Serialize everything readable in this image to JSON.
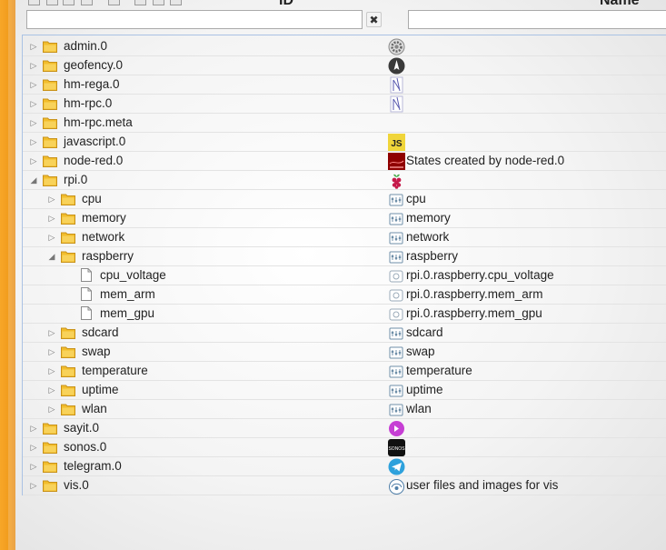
{
  "header": {
    "id_label": "ID",
    "name_label": "Name"
  },
  "filters": {
    "id_value": "",
    "name_value": "",
    "clear_label": "✖"
  },
  "rows": [
    {
      "label": "admin.0",
      "name": "",
      "depth": 0,
      "type": "folder",
      "state": "collapsed",
      "icon": "gear-icon"
    },
    {
      "label": "geofency.0",
      "name": "",
      "depth": 0,
      "type": "folder",
      "state": "collapsed",
      "icon": "compass-icon"
    },
    {
      "label": "hm-rega.0",
      "name": "",
      "depth": 0,
      "type": "folder",
      "state": "collapsed",
      "icon": "homematic-icon"
    },
    {
      "label": "hm-rpc.0",
      "name": "",
      "depth": 0,
      "type": "folder",
      "state": "collapsed",
      "icon": "homematic-icon"
    },
    {
      "label": "hm-rpc.meta",
      "name": "",
      "depth": 0,
      "type": "folder",
      "state": "collapsed",
      "icon": ""
    },
    {
      "label": "javascript.0",
      "name": "",
      "depth": 0,
      "type": "folder",
      "state": "collapsed",
      "icon": "js-icon"
    },
    {
      "label": "node-red.0",
      "name": "States created by node-red.0",
      "depth": 0,
      "type": "folder",
      "state": "collapsed",
      "icon": "node-red-icon"
    },
    {
      "label": "rpi.0",
      "name": "",
      "depth": 0,
      "type": "folder",
      "state": "expanded",
      "icon": "raspberry-icon"
    },
    {
      "label": "cpu",
      "name": "cpu",
      "depth": 1,
      "type": "folder",
      "state": "collapsed",
      "icon": "channel-icon"
    },
    {
      "label": "memory",
      "name": "memory",
      "depth": 1,
      "type": "folder",
      "state": "collapsed",
      "icon": "channel-icon"
    },
    {
      "label": "network",
      "name": "network",
      "depth": 1,
      "type": "folder",
      "state": "collapsed",
      "icon": "channel-icon"
    },
    {
      "label": "raspberry",
      "name": "raspberry",
      "depth": 1,
      "type": "folder",
      "state": "expanded",
      "icon": "channel-icon"
    },
    {
      "label": "cpu_voltage",
      "name": "rpi.0.raspberry.cpu_voltage",
      "depth": 2,
      "type": "file",
      "state": "leaf",
      "icon": "state-icon"
    },
    {
      "label": "mem_arm",
      "name": "rpi.0.raspberry.mem_arm",
      "depth": 2,
      "type": "file",
      "state": "leaf",
      "icon": "state-icon"
    },
    {
      "label": "mem_gpu",
      "name": "rpi.0.raspberry.mem_gpu",
      "depth": 2,
      "type": "file",
      "state": "leaf",
      "icon": "state-icon"
    },
    {
      "label": "sdcard",
      "name": "sdcard",
      "depth": 1,
      "type": "folder",
      "state": "collapsed",
      "icon": "channel-icon"
    },
    {
      "label": "swap",
      "name": "swap",
      "depth": 1,
      "type": "folder",
      "state": "collapsed",
      "icon": "channel-icon"
    },
    {
      "label": "temperature",
      "name": "temperature",
      "depth": 1,
      "type": "folder",
      "state": "collapsed",
      "icon": "channel-icon"
    },
    {
      "label": "uptime",
      "name": "uptime",
      "depth": 1,
      "type": "folder",
      "state": "collapsed",
      "icon": "channel-icon"
    },
    {
      "label": "wlan",
      "name": "wlan",
      "depth": 1,
      "type": "folder",
      "state": "collapsed",
      "icon": "channel-icon"
    },
    {
      "label": "sayit.0",
      "name": "",
      "depth": 0,
      "type": "folder",
      "state": "collapsed",
      "icon": "sayit-icon"
    },
    {
      "label": "sonos.0",
      "name": "",
      "depth": 0,
      "type": "folder",
      "state": "collapsed",
      "icon": "sonos-icon"
    },
    {
      "label": "telegram.0",
      "name": "",
      "depth": 0,
      "type": "folder",
      "state": "collapsed",
      "icon": "telegram-icon"
    },
    {
      "label": "vis.0",
      "name": "user files and images for vis",
      "depth": 0,
      "type": "folder",
      "state": "collapsed",
      "icon": "vis-icon"
    }
  ],
  "colors": {
    "accent_strip": "#f39c1f",
    "tree_border": "#aac2e4",
    "folder": "#f2bd2c"
  }
}
